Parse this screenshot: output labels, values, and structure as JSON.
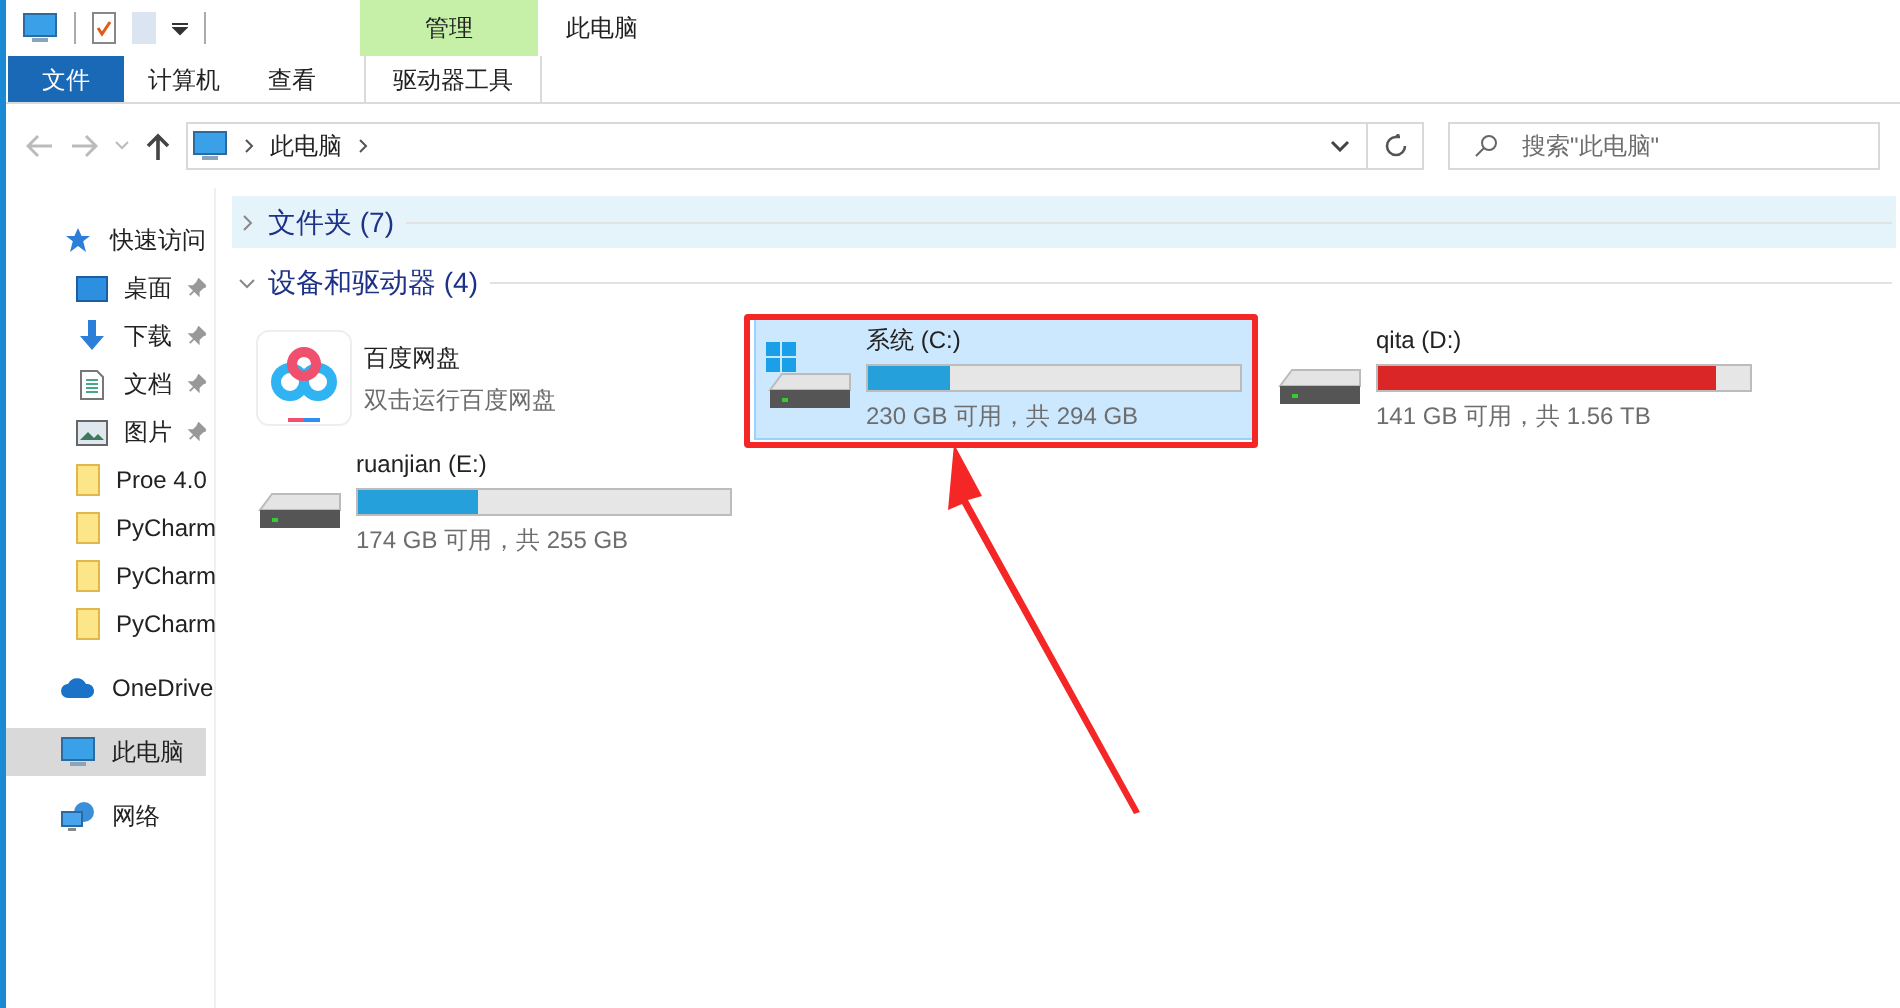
{
  "window": {
    "title": "此电脑"
  },
  "ribbon": {
    "context_group": "管理",
    "tabs": [
      {
        "label": "文件",
        "selected": true,
        "kind": "file"
      },
      {
        "label": "计算机",
        "selected": false,
        "kind": "normal"
      },
      {
        "label": "查看",
        "selected": false,
        "kind": "normal"
      },
      {
        "label": "驱动器工具",
        "selected": false,
        "kind": "context"
      }
    ]
  },
  "address": {
    "path": [
      "此电脑"
    ]
  },
  "search": {
    "placeholder": "搜索\"此电脑\""
  },
  "sidebar": {
    "items": [
      {
        "label": "快速访问",
        "kind": "quick",
        "selected": false,
        "children": [
          {
            "label": "桌面",
            "kind": "desktop",
            "pinned": true,
            "selected": false
          },
          {
            "label": "下载",
            "kind": "download",
            "pinned": true,
            "selected": false
          },
          {
            "label": "文档",
            "kind": "document",
            "pinned": true,
            "selected": false
          },
          {
            "label": "图片",
            "kind": "picture",
            "pinned": true,
            "selected": false
          },
          {
            "label": "Proe 4.0",
            "kind": "folder",
            "selected": false
          },
          {
            "label": "PyCharm",
            "kind": "folder",
            "selected": false
          },
          {
            "label": "PyCharm",
            "kind": "folder",
            "selected": false
          },
          {
            "label": "PyCharm",
            "kind": "folder",
            "selected": false
          }
        ]
      },
      {
        "label": "OneDrive",
        "kind": "cloud",
        "selected": false
      },
      {
        "label": "此电脑",
        "kind": "pc",
        "selected": true
      },
      {
        "label": "网络",
        "kind": "network",
        "selected": false
      }
    ]
  },
  "groups": [
    {
      "title": "文件夹 (7)",
      "expanded": false
    },
    {
      "title": "设备和驱动器 (4)",
      "expanded": true,
      "items": [
        {
          "kind": "app",
          "name": "百度网盘",
          "subtitle": "双击运行百度网盘",
          "selected": false
        },
        {
          "kind": "drive",
          "name": "系统 (C:)",
          "system": true,
          "level": 0.22,
          "low_space": false,
          "reading": "230 GB 可用，共 294 GB",
          "selected": true
        },
        {
          "kind": "drive",
          "name": "qita (D:)",
          "system": false,
          "level": 0.91,
          "low_space": true,
          "reading": "141 GB 可用，共 1.56 TB",
          "selected": false
        },
        {
          "kind": "drive",
          "name": "ruanjian (E:)",
          "system": false,
          "level": 0.32,
          "low_space": false,
          "reading": "174 GB 可用，共 255 GB",
          "selected": false
        }
      ]
    }
  ]
}
